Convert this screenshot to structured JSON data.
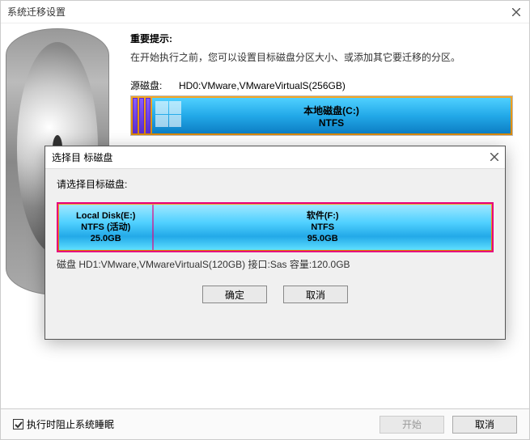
{
  "main": {
    "title": "系统迁移设置",
    "heading": "重要提示:",
    "instruction": "在开始执行之前，您可以设置目标磁盘分区大小、或添加其它要迁移的分区。",
    "sourceLabel": "源磁盘:",
    "sourceValue": "HD0:VMware,VMwareVirtualS(256GB)",
    "sourcePartition": {
      "name": "本地磁盘(C:)",
      "fs": "NTFS"
    },
    "checkbox": "执行时阻止系统睡眠",
    "startBtn": "开始",
    "cancelBtn": "取消"
  },
  "modal": {
    "title": "选择目 标磁盘",
    "prompt": "请选择目标磁盘:",
    "partitions": [
      {
        "label": "Local Disk(E:)",
        "fs": "NTFS (活动)",
        "size": "25.0GB",
        "width": 22
      },
      {
        "label": "软件(F:)",
        "fs": "NTFS",
        "size": "95.0GB",
        "width": 78
      }
    ],
    "diskInfo": "磁盘 HD1:VMware,VMwareVirtualS(120GB)  接口:Sas  容量:120.0GB",
    "okBtn": "确定",
    "cancelBtn": "取消"
  }
}
